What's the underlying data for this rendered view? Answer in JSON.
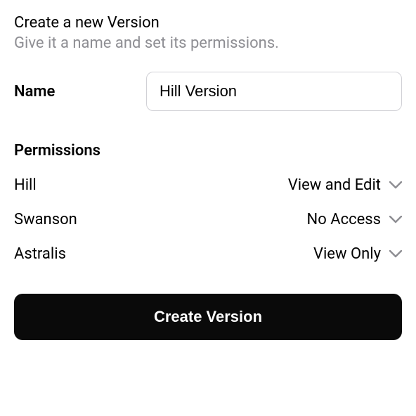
{
  "header": {
    "title": "Create a new Version",
    "subtitle": "Give it a name and set its permissions."
  },
  "name": {
    "label": "Name",
    "value": "Hill Version"
  },
  "permissions": {
    "header": "Permissions",
    "rows": [
      {
        "name": "Hill",
        "value": "View and Edit"
      },
      {
        "name": "Swanson",
        "value": "No Access"
      },
      {
        "name": "Astralis",
        "value": "View Only"
      }
    ]
  },
  "actions": {
    "create_label": "Create Version"
  }
}
